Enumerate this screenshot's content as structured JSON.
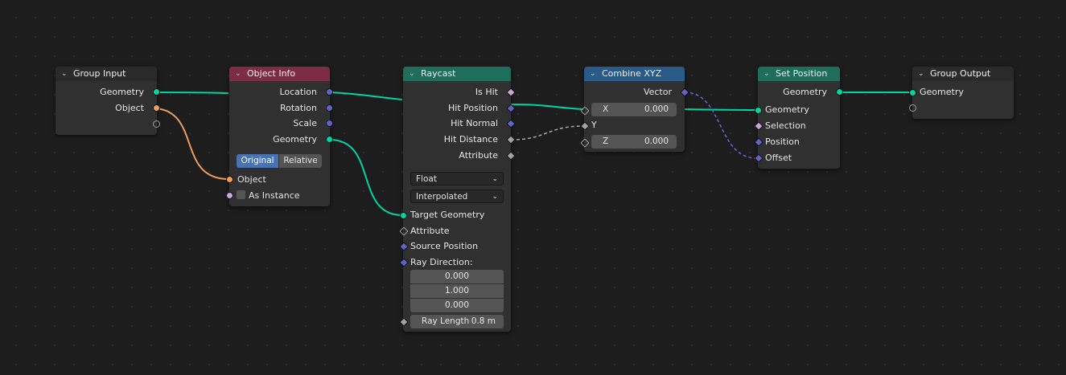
{
  "nodes": {
    "group_input": {
      "title": "Group Input",
      "outputs": [
        "Geometry",
        "Object"
      ]
    },
    "object_info": {
      "title": "Object Info",
      "outputs": [
        "Location",
        "Rotation",
        "Scale",
        "Geometry"
      ],
      "mode_options": [
        "Original",
        "Relative"
      ],
      "mode_selected": "Original",
      "inputs": [
        "Object",
        "As Instance"
      ]
    },
    "raycast": {
      "title": "Raycast",
      "outputs": [
        "Is Hit",
        "Hit Position",
        "Hit Normal",
        "Hit Distance",
        "Attribute"
      ],
      "data_type": "Float",
      "mapping": "Interpolated",
      "inputs": [
        "Target Geometry",
        "Attribute",
        "Source Position",
        "Ray Direction:"
      ],
      "ray_direction": [
        "0.000",
        "1.000",
        "0.000"
      ],
      "ray_length_label": "Ray Length",
      "ray_length_value": "0.8 m"
    },
    "combine_xyz": {
      "title": "Combine XYZ",
      "output": "Vector",
      "x_label": "X",
      "x_value": "0.000",
      "y_label": "Y",
      "z_label": "Z",
      "z_value": "0.000"
    },
    "set_position": {
      "title": "Set Position",
      "output": "Geometry",
      "inputs": [
        "Geometry",
        "Selection",
        "Position",
        "Offset"
      ]
    },
    "group_output": {
      "title": "Group Output",
      "inputs": [
        "Geometry"
      ]
    }
  },
  "icons": {
    "collapse": "chevron-down-icon",
    "dropdown": "dropdown-arrow-icon"
  },
  "colors": {
    "background": "#1d1d1d",
    "node_body": "#303030",
    "geometry_header": "#1f6e5c",
    "input_header": "#7c2c45",
    "converter_header": "#2a5a86",
    "geometry_socket": "#00d6a3",
    "vector_socket": "#6363c7",
    "object_socket": "#ed9e5c",
    "boolean_socket": "#cca6d6",
    "float_socket": "#a1a1a1",
    "selected_button": "#4772b3"
  }
}
